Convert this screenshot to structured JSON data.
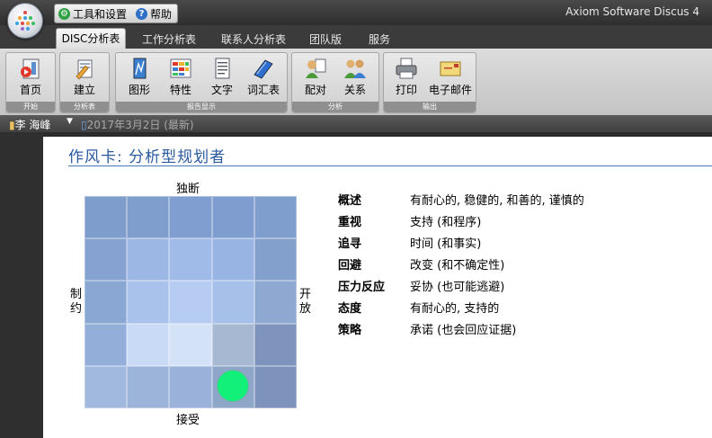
{
  "app": {
    "title": "Axiom Software Discus 4",
    "quick_access": [
      {
        "label": "工具和设置",
        "icon": "tools-settings-icon",
        "color": "#2ea043"
      },
      {
        "label": "帮助",
        "icon": "help-icon",
        "color": "#2f6fc7"
      }
    ]
  },
  "tabs": [
    {
      "label": "DISC分析表",
      "active": true
    },
    {
      "label": "工作分析表",
      "active": false
    },
    {
      "label": "联系人分析表",
      "active": false
    },
    {
      "label": "团队版",
      "active": false
    },
    {
      "label": "服务",
      "active": false
    }
  ],
  "ribbon": {
    "groups": [
      {
        "label": "开始",
        "buttons": [
          {
            "label": "首页",
            "icon": "home-icon"
          }
        ]
      },
      {
        "label": "分析表",
        "buttons": [
          {
            "label": "建立",
            "icon": "create-icon"
          }
        ]
      },
      {
        "label": "报告显示",
        "buttons": [
          {
            "label": "图形",
            "icon": "graph-icon"
          },
          {
            "label": "特性",
            "icon": "traits-icon"
          },
          {
            "label": "文字",
            "icon": "text-document-icon"
          },
          {
            "label": "词汇表",
            "icon": "glossary-book-icon"
          }
        ]
      },
      {
        "label": "分析",
        "buttons": [
          {
            "label": "配对",
            "icon": "pair-people-icon"
          },
          {
            "label": "关系",
            "icon": "relationship-people-icon"
          }
        ]
      },
      {
        "label": "输出",
        "buttons": [
          {
            "label": "打印",
            "icon": "printer-icon"
          },
          {
            "label": "电子邮件",
            "icon": "email-icon"
          }
        ]
      }
    ]
  },
  "user_bar": {
    "user": "李 海峰",
    "date": "2017年3月2日 (最新)"
  },
  "card": {
    "title": "作风卡: 分析型规划者",
    "axes": {
      "top": "独断",
      "bottom": "接受",
      "left": "制约",
      "right": "开放"
    },
    "grid_colors": [
      [
        "#7e9ccc",
        "#7f9dcd",
        "#809ecf",
        "#7f9dcf",
        "#7f9dcd"
      ],
      [
        "#86a2d0",
        "#9cb7e4",
        "#a0bbe8",
        "#98b4e2",
        "#839fcb"
      ],
      [
        "#8aa6d2",
        "#a9c2ec",
        "#b6ccf2",
        "#a6c0ea",
        "#8ea8d2"
      ],
      [
        "#93aed8",
        "#c9daf6",
        "#d4e2f8",
        "#a7b8d2",
        "#7e94bd"
      ],
      [
        "#a2b9df",
        "#9cb4da",
        "#9ab2da",
        "#8ea6c8",
        "#7d93bc"
      ]
    ],
    "marker": {
      "row": 5,
      "col": 4,
      "color": "#12f07a"
    },
    "facts": [
      {
        "key": "概述",
        "value": "有耐心的, 稳健的, 和善的, 谨慎的"
      },
      {
        "key": "重视",
        "value": "支持 (和程序)"
      },
      {
        "key": "追寻",
        "value": "时间 (和事实)"
      },
      {
        "key": "回避",
        "value": "改变 (和不确定性)"
      },
      {
        "key": "压力反应",
        "value": "妥协 (也可能逃避)"
      },
      {
        "key": "态度",
        "value": "有耐心的, 支持的"
      },
      {
        "key": "策略",
        "value": "承诺 (也会回应证据)"
      }
    ]
  }
}
